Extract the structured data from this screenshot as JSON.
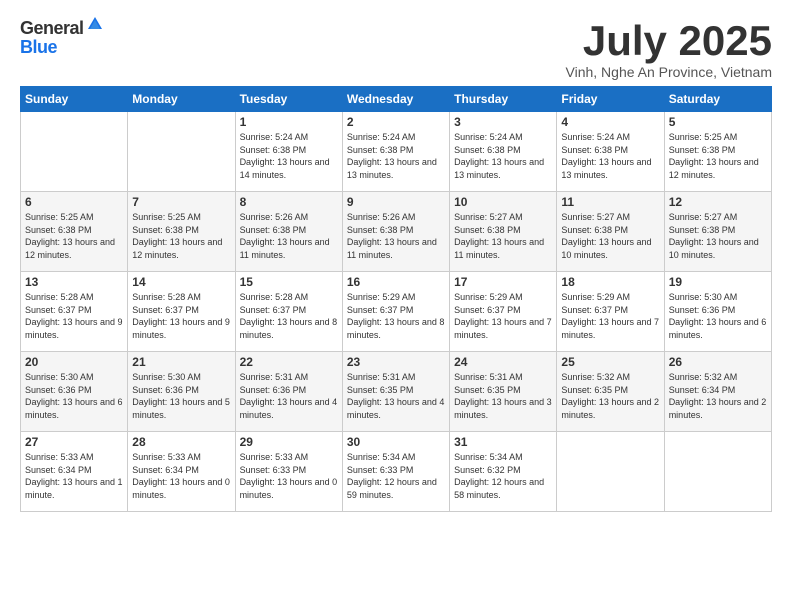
{
  "logo": {
    "general": "General",
    "blue": "Blue"
  },
  "title": {
    "month": "July 2025",
    "location": "Vinh, Nghe An Province, Vietnam"
  },
  "days_of_week": [
    "Sunday",
    "Monday",
    "Tuesday",
    "Wednesday",
    "Thursday",
    "Friday",
    "Saturday"
  ],
  "weeks": [
    [
      {
        "day": "",
        "sunrise": "",
        "sunset": "",
        "daylight": ""
      },
      {
        "day": "",
        "sunrise": "",
        "sunset": "",
        "daylight": ""
      },
      {
        "day": "1",
        "sunrise": "Sunrise: 5:24 AM",
        "sunset": "Sunset: 6:38 PM",
        "daylight": "Daylight: 13 hours and 14 minutes."
      },
      {
        "day": "2",
        "sunrise": "Sunrise: 5:24 AM",
        "sunset": "Sunset: 6:38 PM",
        "daylight": "Daylight: 13 hours and 13 minutes."
      },
      {
        "day": "3",
        "sunrise": "Sunrise: 5:24 AM",
        "sunset": "Sunset: 6:38 PM",
        "daylight": "Daylight: 13 hours and 13 minutes."
      },
      {
        "day": "4",
        "sunrise": "Sunrise: 5:24 AM",
        "sunset": "Sunset: 6:38 PM",
        "daylight": "Daylight: 13 hours and 13 minutes."
      },
      {
        "day": "5",
        "sunrise": "Sunrise: 5:25 AM",
        "sunset": "Sunset: 6:38 PM",
        "daylight": "Daylight: 13 hours and 12 minutes."
      }
    ],
    [
      {
        "day": "6",
        "sunrise": "Sunrise: 5:25 AM",
        "sunset": "Sunset: 6:38 PM",
        "daylight": "Daylight: 13 hours and 12 minutes."
      },
      {
        "day": "7",
        "sunrise": "Sunrise: 5:25 AM",
        "sunset": "Sunset: 6:38 PM",
        "daylight": "Daylight: 13 hours and 12 minutes."
      },
      {
        "day": "8",
        "sunrise": "Sunrise: 5:26 AM",
        "sunset": "Sunset: 6:38 PM",
        "daylight": "Daylight: 13 hours and 11 minutes."
      },
      {
        "day": "9",
        "sunrise": "Sunrise: 5:26 AM",
        "sunset": "Sunset: 6:38 PM",
        "daylight": "Daylight: 13 hours and 11 minutes."
      },
      {
        "day": "10",
        "sunrise": "Sunrise: 5:27 AM",
        "sunset": "Sunset: 6:38 PM",
        "daylight": "Daylight: 13 hours and 11 minutes."
      },
      {
        "day": "11",
        "sunrise": "Sunrise: 5:27 AM",
        "sunset": "Sunset: 6:38 PM",
        "daylight": "Daylight: 13 hours and 10 minutes."
      },
      {
        "day": "12",
        "sunrise": "Sunrise: 5:27 AM",
        "sunset": "Sunset: 6:38 PM",
        "daylight": "Daylight: 13 hours and 10 minutes."
      }
    ],
    [
      {
        "day": "13",
        "sunrise": "Sunrise: 5:28 AM",
        "sunset": "Sunset: 6:37 PM",
        "daylight": "Daylight: 13 hours and 9 minutes."
      },
      {
        "day": "14",
        "sunrise": "Sunrise: 5:28 AM",
        "sunset": "Sunset: 6:37 PM",
        "daylight": "Daylight: 13 hours and 9 minutes."
      },
      {
        "day": "15",
        "sunrise": "Sunrise: 5:28 AM",
        "sunset": "Sunset: 6:37 PM",
        "daylight": "Daylight: 13 hours and 8 minutes."
      },
      {
        "day": "16",
        "sunrise": "Sunrise: 5:29 AM",
        "sunset": "Sunset: 6:37 PM",
        "daylight": "Daylight: 13 hours and 8 minutes."
      },
      {
        "day": "17",
        "sunrise": "Sunrise: 5:29 AM",
        "sunset": "Sunset: 6:37 PM",
        "daylight": "Daylight: 13 hours and 7 minutes."
      },
      {
        "day": "18",
        "sunrise": "Sunrise: 5:29 AM",
        "sunset": "Sunset: 6:37 PM",
        "daylight": "Daylight: 13 hours and 7 minutes."
      },
      {
        "day": "19",
        "sunrise": "Sunrise: 5:30 AM",
        "sunset": "Sunset: 6:36 PM",
        "daylight": "Daylight: 13 hours and 6 minutes."
      }
    ],
    [
      {
        "day": "20",
        "sunrise": "Sunrise: 5:30 AM",
        "sunset": "Sunset: 6:36 PM",
        "daylight": "Daylight: 13 hours and 6 minutes."
      },
      {
        "day": "21",
        "sunrise": "Sunrise: 5:30 AM",
        "sunset": "Sunset: 6:36 PM",
        "daylight": "Daylight: 13 hours and 5 minutes."
      },
      {
        "day": "22",
        "sunrise": "Sunrise: 5:31 AM",
        "sunset": "Sunset: 6:36 PM",
        "daylight": "Daylight: 13 hours and 4 minutes."
      },
      {
        "day": "23",
        "sunrise": "Sunrise: 5:31 AM",
        "sunset": "Sunset: 6:35 PM",
        "daylight": "Daylight: 13 hours and 4 minutes."
      },
      {
        "day": "24",
        "sunrise": "Sunrise: 5:31 AM",
        "sunset": "Sunset: 6:35 PM",
        "daylight": "Daylight: 13 hours and 3 minutes."
      },
      {
        "day": "25",
        "sunrise": "Sunrise: 5:32 AM",
        "sunset": "Sunset: 6:35 PM",
        "daylight": "Daylight: 13 hours and 2 minutes."
      },
      {
        "day": "26",
        "sunrise": "Sunrise: 5:32 AM",
        "sunset": "Sunset: 6:34 PM",
        "daylight": "Daylight: 13 hours and 2 minutes."
      }
    ],
    [
      {
        "day": "27",
        "sunrise": "Sunrise: 5:33 AM",
        "sunset": "Sunset: 6:34 PM",
        "daylight": "Daylight: 13 hours and 1 minute."
      },
      {
        "day": "28",
        "sunrise": "Sunrise: 5:33 AM",
        "sunset": "Sunset: 6:34 PM",
        "daylight": "Daylight: 13 hours and 0 minutes."
      },
      {
        "day": "29",
        "sunrise": "Sunrise: 5:33 AM",
        "sunset": "Sunset: 6:33 PM",
        "daylight": "Daylight: 13 hours and 0 minutes."
      },
      {
        "day": "30",
        "sunrise": "Sunrise: 5:34 AM",
        "sunset": "Sunset: 6:33 PM",
        "daylight": "Daylight: 12 hours and 59 minutes."
      },
      {
        "day": "31",
        "sunrise": "Sunrise: 5:34 AM",
        "sunset": "Sunset: 6:32 PM",
        "daylight": "Daylight: 12 hours and 58 minutes."
      },
      {
        "day": "",
        "sunrise": "",
        "sunset": "",
        "daylight": ""
      },
      {
        "day": "",
        "sunrise": "",
        "sunset": "",
        "daylight": ""
      }
    ]
  ]
}
